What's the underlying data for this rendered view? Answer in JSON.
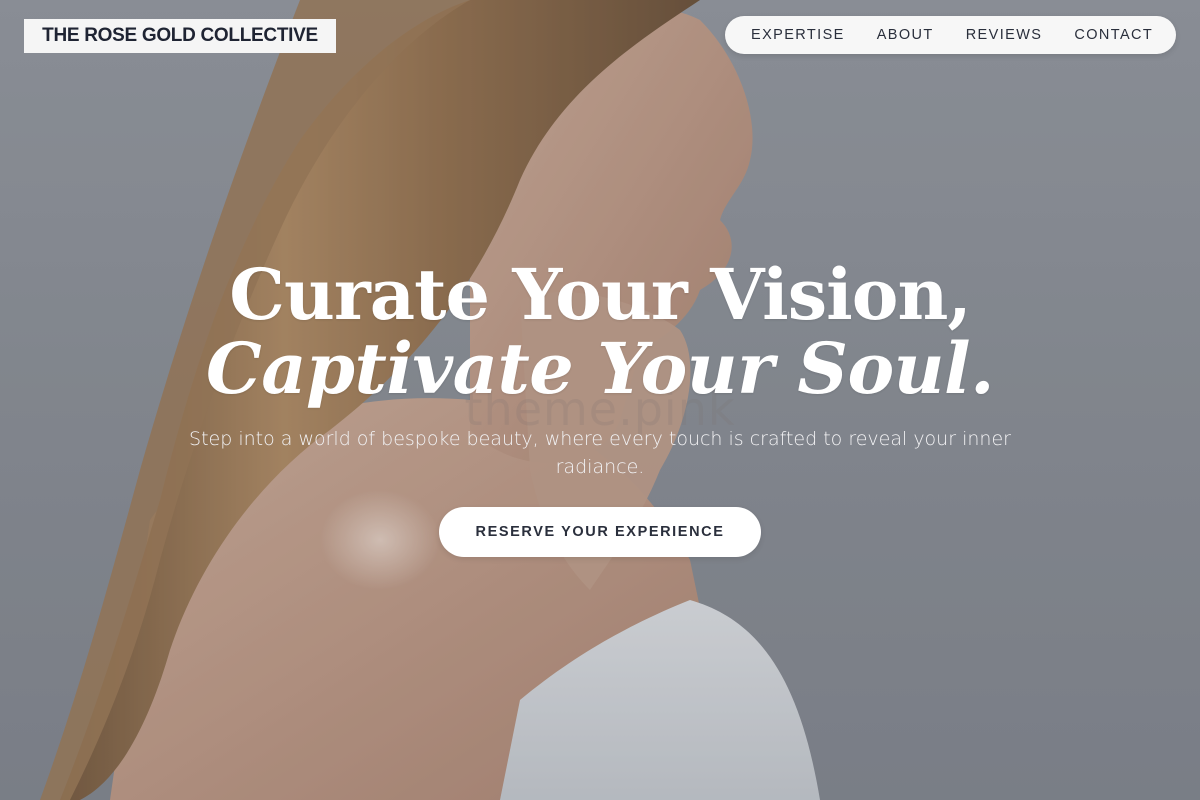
{
  "brand": {
    "name": "THE ROSE GOLD COLLECTIVE"
  },
  "nav": {
    "items": [
      {
        "label": "EXPERTISE"
      },
      {
        "label": "ABOUT"
      },
      {
        "label": "REVIEWS"
      },
      {
        "label": "CONTACT"
      }
    ]
  },
  "hero": {
    "headline_line1": "Curate Your Vision,",
    "headline_line2": "Captivate Your Soul.",
    "subtext": "Step into a world of bespoke beauty, where every touch is crafted to reveal your inner radiance.",
    "cta_label": "RESERVE YOUR EXPERIENCE",
    "watermark": "theme.pink"
  },
  "colors": {
    "background": "#8d9199",
    "text_dark": "#1f2433",
    "pill_bg": "#f7f7f7",
    "white": "#ffffff"
  }
}
